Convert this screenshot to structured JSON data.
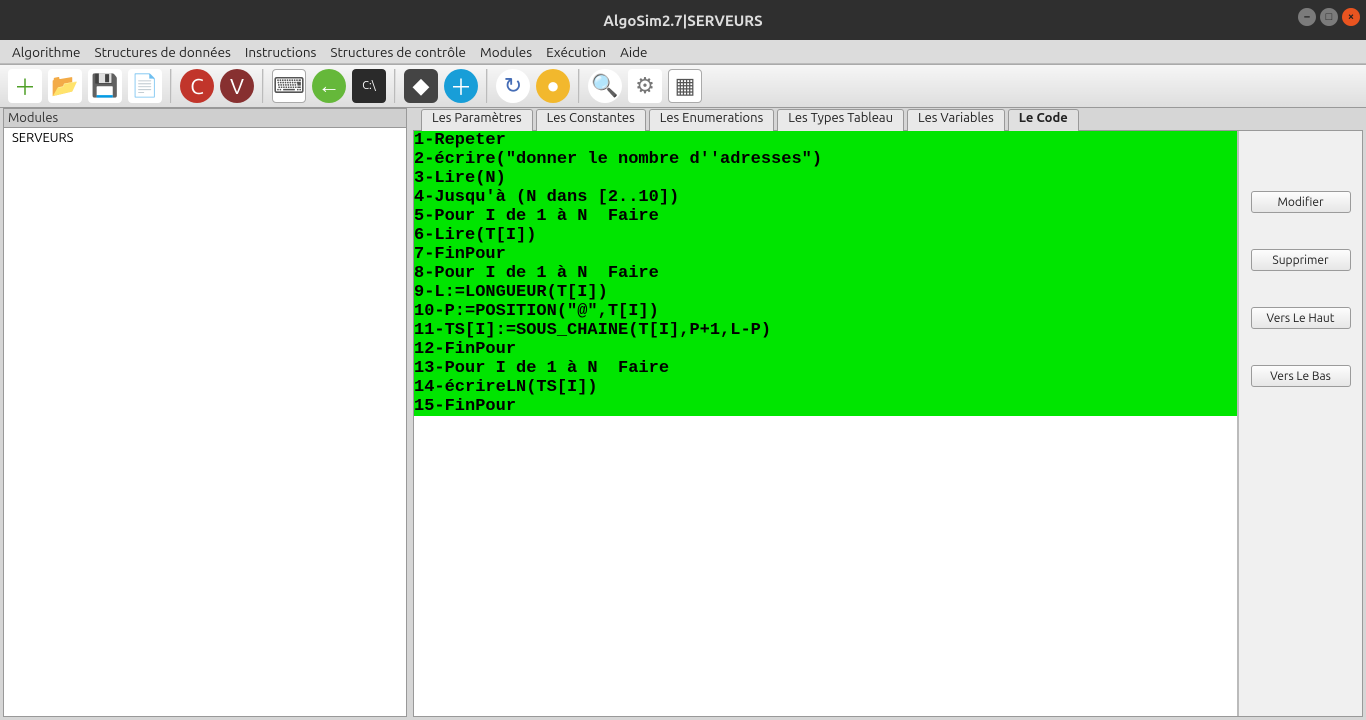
{
  "title": "AlgoSim2.7|SERVEURS",
  "menu": {
    "algorithme": "Algorithme",
    "structures_donnees": "Structures de données",
    "instructions": "Instructions",
    "structures_controle": "Structures de contrôle",
    "modules": "Modules",
    "execution": "Exécution",
    "aide": "Aide"
  },
  "sidebar": {
    "head": "Modules",
    "item0": "SERVEURS"
  },
  "tabs": {
    "parametres": "Les Paramètres",
    "constantes": "Les Constantes",
    "enumerations": "Les Enumerations",
    "types_tableau": "Les Types Tableau",
    "variables": "Les Variables",
    "code": "Le Code"
  },
  "code_block": "1-Repeter\n2-écrire(\"donner le nombre d''adresses\")\n3-Lire(N)\n4-Jusqu'à (N dans [2..10])\n5-Pour I de 1 à N  Faire\n6-Lire(T[I])\n7-FinPour\n8-Pour I de 1 à N  Faire\n9-L:=LONGUEUR(T[I])\n10-P:=POSITION(\"@\",T[I])\n11-TS[I]:=SOUS_CHAINE(T[I],P+1,L-P)\n12-FinPour\n13-Pour I de 1 à N  Faire\n14-écrireLN(TS[I])\n15-FinPour",
  "buttons": {
    "modifier": "Modifier",
    "supprimer": "Supprimer",
    "vers_le_haut": "Vers Le Haut",
    "vers_le_bas": "Vers Le Bas"
  },
  "toolbar_icons": {
    "new": "＋",
    "open": "📂",
    "save": "💾",
    "pdf": "📄",
    "c": "C",
    "v": "V",
    "box": "⌨",
    "back": "←",
    "term": "C:\\",
    "cube": "◆",
    "plus": "＋",
    "refresh": "↻",
    "circle": "●",
    "zoom": "🔍",
    "gear": "⚙",
    "win": "▦"
  }
}
